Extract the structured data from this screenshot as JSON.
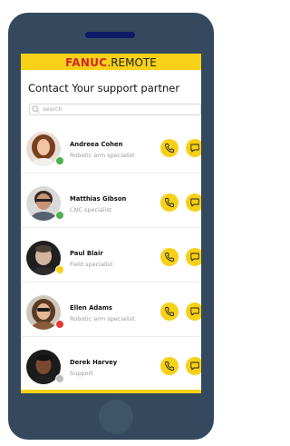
{
  "brand": {
    "name": "FANUC",
    "suffix": ".REMOTE",
    "primary_color": "#f7d117",
    "accent_color": "#d4232a"
  },
  "page_title": "Contact Your support partner",
  "search": {
    "placeholder": "search",
    "icon": "search-icon"
  },
  "contacts": [
    {
      "name": "Andreea Cohen",
      "role": "Robotic arm specialist",
      "status": "online",
      "status_color": "#4caf50"
    },
    {
      "name": "Matthias Gibson",
      "role": "CNC specialist",
      "status": "online",
      "status_color": "#4caf50"
    },
    {
      "name": "Paul Blair",
      "role": "Field specialist",
      "status": "away",
      "status_color": "#f7d117"
    },
    {
      "name": "Ellen Adams",
      "role": "Robotic arm specialist",
      "status": "busy",
      "status_color": "#e53935"
    },
    {
      "name": "Derek  Harvey",
      "role": "Support",
      "status": "offline",
      "status_color": "#bdbdbd"
    }
  ],
  "actions": {
    "call_icon": "phone-icon",
    "chat_icon": "chat-bubble-icon"
  }
}
